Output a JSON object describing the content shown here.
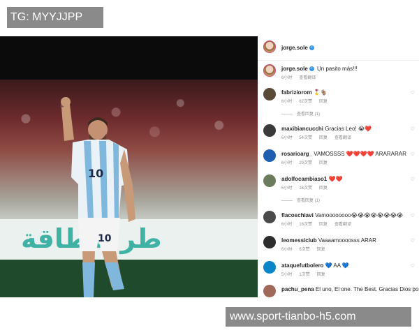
{
  "tg_label": "TG: MYYJJPP",
  "watermark": "www.sport-tianbo-h5.com",
  "post": {
    "author": "jorge.sole",
    "caption": {
      "user": "jorge.sole",
      "text": "Un pasito más!!!",
      "time": "6小时",
      "translate": "查看翻译"
    },
    "photo_banner_text": "طر للطاقة",
    "jersey_number": "10",
    "comments": [
      {
        "user": "fabriziorom",
        "text": "🎖️🐐",
        "time": "6小时",
        "likes": "62次赞",
        "reply": "回复",
        "view_replies": "查看回复 (1)",
        "avatar_color": "#5a4a3a"
      },
      {
        "user": "maxibiancucchi",
        "text": "Gracias Leo! 😭❤️",
        "time": "6小时",
        "likes": "54次赞",
        "reply": "回复",
        "translate": "查看翻译",
        "avatar_color": "#3a3a3a"
      },
      {
        "user": "rosarioarg_",
        "text": "VAMOSSSS ❤️❤️❤️❤️ ARARARAR",
        "time": "6小时",
        "likes": "29次赞",
        "reply": "回复",
        "avatar_color": "#1f5fb0"
      },
      {
        "user": "adolfocambiaso1",
        "text": "❤️❤️",
        "time": "6小时",
        "likes": "16次赞",
        "reply": "回复",
        "view_replies": "查看回复 (1)",
        "avatar_color": "#6a7a5a"
      },
      {
        "user": "flacoschiavi",
        "text": "Vamoooooooo😭😭😭😭😭😭😭😭",
        "time": "6小时",
        "likes": "16次赞",
        "reply": "回复",
        "translate": "查看翻译",
        "avatar_color": "#4a4a4a"
      },
      {
        "user": "leomessiclub",
        "text": "Vaaaamoooosss ARAR",
        "time": "6小时",
        "likes": "6次赞",
        "reply": "回复",
        "avatar_color": "#2d2d2d"
      },
      {
        "user": "ataquefutbolero",
        "text": "💙 AA 💙",
        "time": "5小时",
        "likes": "1次赞",
        "reply": "回复",
        "avatar_color": "#0a86c8"
      },
      {
        "user": "pachu_pena",
        "text": "El uno, El one. The Best. Gracias Dios por dejar",
        "time": "",
        "likes": "",
        "reply": "",
        "avatar_color": "#a06a5a"
      }
    ]
  }
}
